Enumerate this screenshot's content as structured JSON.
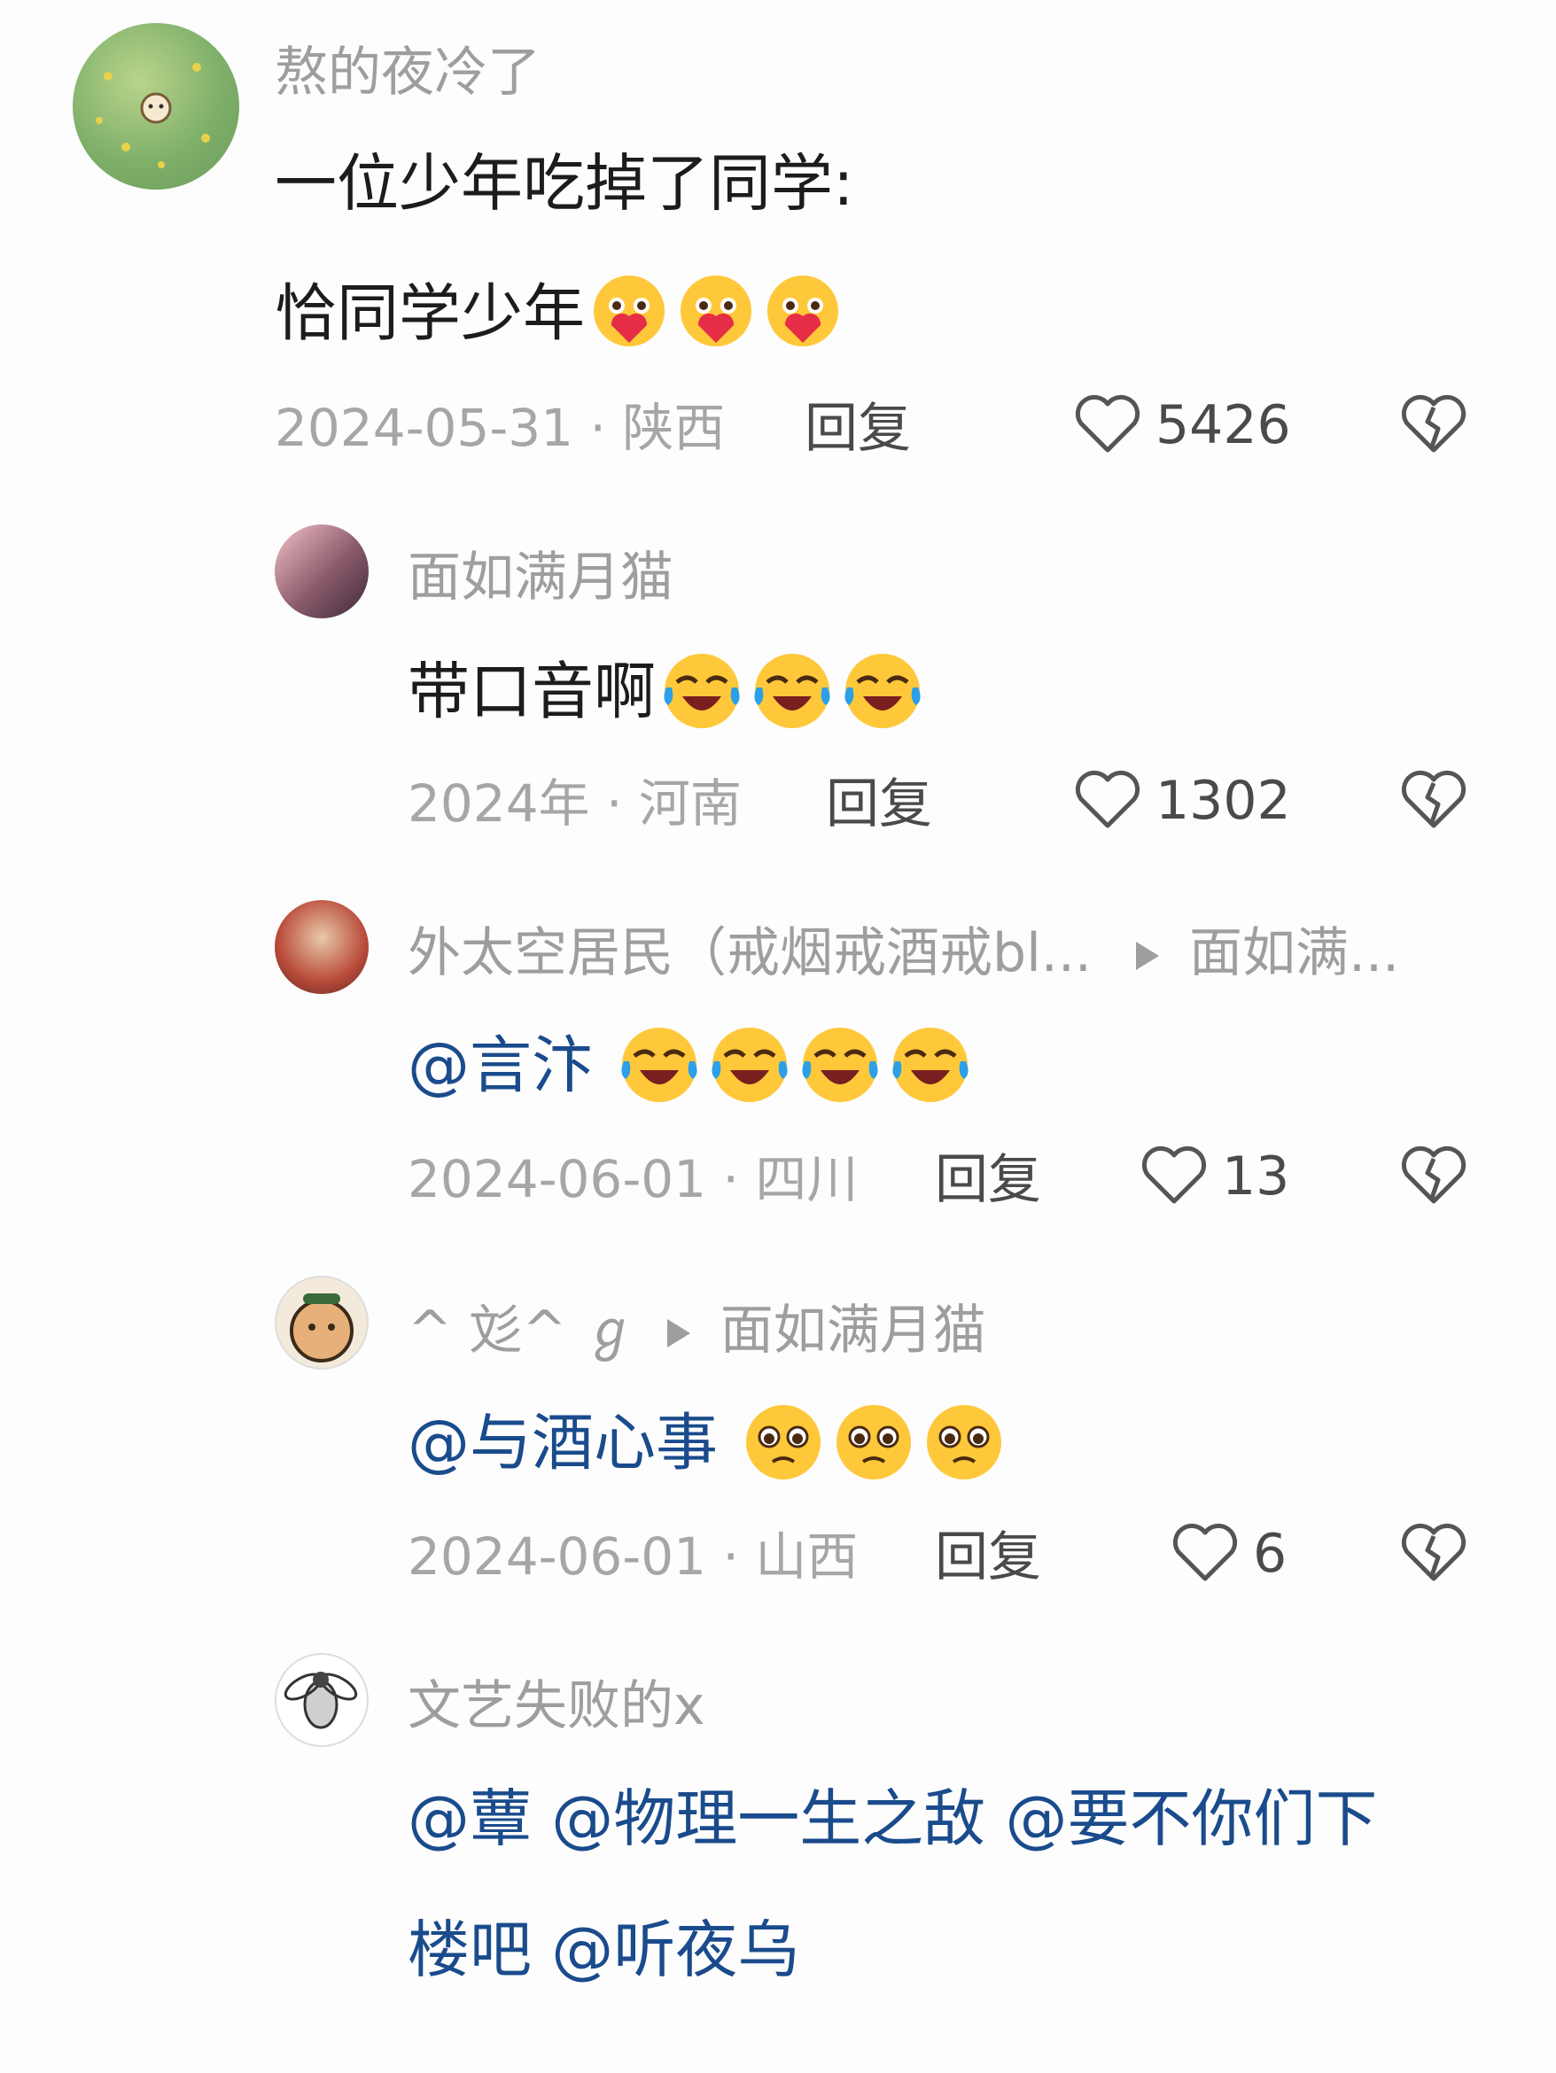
{
  "comments": [
    {
      "username": "熬的夜冷了",
      "line1": "一位少年吃掉了同学:",
      "line2": "恰同学少年",
      "date_loc": "2024-05-31 · 陕西",
      "reply_label": "回复",
      "likes": "5426"
    },
    {
      "username": "面如满月猫",
      "text": "带口音啊",
      "date_loc": "2024年 · 河南",
      "reply_label": "回复",
      "likes": "1302"
    },
    {
      "username": "外太空居民（戒烟戒酒戒bl...",
      "reply_to": "面如满...",
      "text": "@言汴",
      "date_loc": "2024-06-01 · 四川",
      "reply_label": "回复",
      "likes": "13"
    },
    {
      "username": "^ 彣^ ℊ",
      "reply_to": "面如满月猫",
      "text": "@与酒心事",
      "date_loc": "2024-06-01 · 山西",
      "reply_label": "回复",
      "likes": "6"
    },
    {
      "username": "文艺失败的x",
      "line1": "@蕈 @物理一生之敌 @要不你们下",
      "line2": "楼吧 @听夜乌"
    }
  ],
  "icons": {
    "like": "heart-outline-icon",
    "dislike": "broken-heart-icon",
    "reply_to": "play-arrow-icon"
  }
}
